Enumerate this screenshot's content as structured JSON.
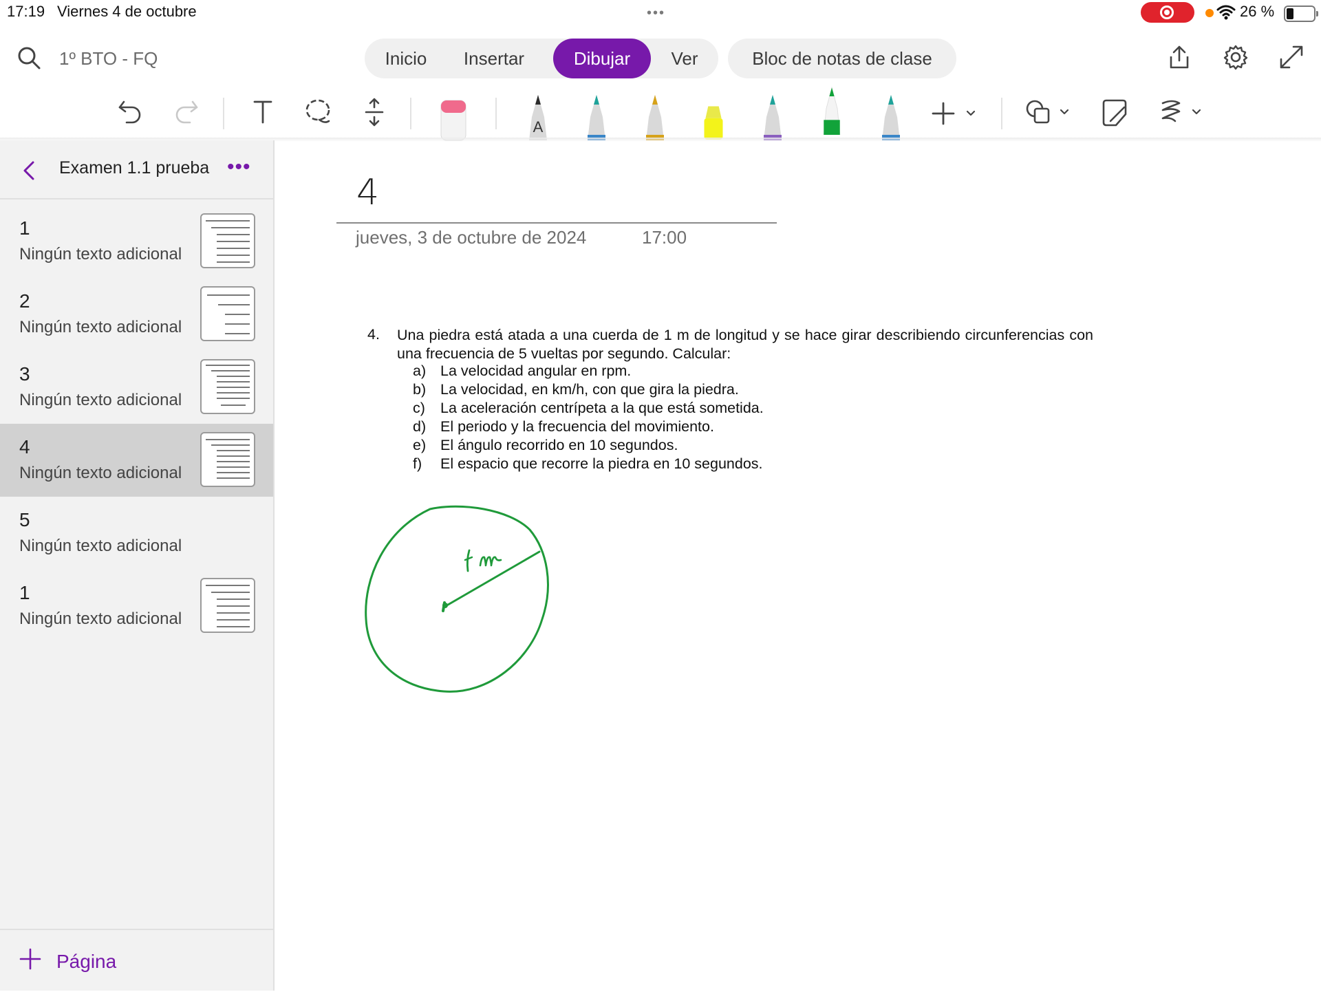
{
  "status_bar": {
    "time": "17:19",
    "date": "Viernes 4 de octubre",
    "multitask_dots": "•••",
    "battery_text": "26 %",
    "recording_color": "#e0232c"
  },
  "header": {
    "notebook_name": "1º BTO - FQ",
    "tabs": [
      "Inicio",
      "Insertar",
      "Dibujar",
      "Ver"
    ],
    "active_tab": "Dibujar",
    "class_notebook": "Bloc de notas de clase",
    "accent_color": "#7719aa"
  },
  "toolbar": {
    "tools": [
      "undo-icon",
      "redo-icon",
      "text-icon",
      "lasso-icon",
      "add-space-icon",
      "eraser-icon"
    ],
    "pens": [
      {
        "name": "pen-black",
        "color": "#2b2b2b",
        "label": "A"
      },
      {
        "name": "pen-teal",
        "color": "#1fa39a"
      },
      {
        "name": "pen-gold",
        "color": "#d6a21a"
      },
      {
        "name": "highlighter-yellow",
        "color": "#f3f31a"
      },
      {
        "name": "pen-teal-2",
        "color": "#1fa39a"
      },
      {
        "name": "pen-green",
        "color": "#12a33a"
      },
      {
        "name": "pen-teal-3",
        "color": "#1fa39a"
      }
    ]
  },
  "sidebar": {
    "section_title": "Examen 1.1 prueba",
    "more": "•••",
    "pages": [
      {
        "number": "1",
        "subtitle": "Ningún texto adicional",
        "thumb": true
      },
      {
        "number": "2",
        "subtitle": "Ningún texto adicional",
        "thumb": true
      },
      {
        "number": "3",
        "subtitle": "Ningún texto adicional",
        "thumb": true
      },
      {
        "number": "4",
        "subtitle": "Ningún texto adicional",
        "thumb": true,
        "selected": true
      },
      {
        "number": "5",
        "subtitle": "Ningún texto adicional",
        "thumb": false
      },
      {
        "number": "1",
        "subtitle": "Ningún texto adicional",
        "thumb": true
      }
    ],
    "add_page": "Página"
  },
  "page": {
    "title": "4",
    "date": "jueves, 3 de octubre de 2024",
    "time": "17:00",
    "question": {
      "number": "4.",
      "text": "Una piedra está atada a una cuerda de 1 m de longitud y se hace girar describiendo circunferencias con una frecuencia de 5 vueltas por segundo. Calcular:",
      "items": [
        {
          "letter": "a)",
          "text": "La velocidad angular en rpm."
        },
        {
          "letter": "b)",
          "text": "La velocidad, en km/h, con que gira la piedra."
        },
        {
          "letter": "c)",
          "text": "La aceleración centrípeta a la que está sometida."
        },
        {
          "letter": "d)",
          "text": "El periodo y la frecuencia del movimiento."
        },
        {
          "letter": "e)",
          "text": "El ángulo recorrido en 10 segundos."
        },
        {
          "letter": "f)",
          "text": "El espacio que recorre la piedra en 10 segundos."
        }
      ]
    },
    "ink": {
      "color": "#1f9a3a",
      "annotation": "1 m"
    }
  }
}
